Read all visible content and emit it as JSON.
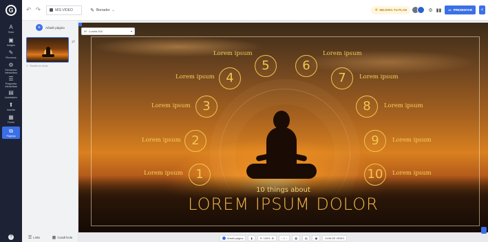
{
  "toolbar": {
    "file_name": "MIS VIDEO",
    "draft_label": "Borrador",
    "upgrade_label": "MEJORA TU PLAN",
    "present_label": "PRESENTAR"
  },
  "sidebar": {
    "items": [
      {
        "icon": "A",
        "label": "Texto"
      },
      {
        "icon": "▣",
        "label": "Imagen"
      },
      {
        "icon": "✎",
        "label": "Recursos"
      },
      {
        "icon": "⚙",
        "label": "Elementos interactivos"
      },
      {
        "icon": "☰",
        "label": "Preguntas interactivas"
      },
      {
        "icon": "▤",
        "label": "Insertables"
      },
      {
        "icon": "⬆",
        "label": "Insertar"
      },
      {
        "icon": "▦",
        "label": "Fondo"
      },
      {
        "icon": "⧉",
        "label": "Páginas"
      }
    ]
  },
  "pages_panel": {
    "add_page_label": "Añadir página",
    "thumb_label": "1 · Escrito en título",
    "footer": [
      {
        "icon": "☰",
        "label": "Lista"
      },
      {
        "icon": "▦",
        "label": "Cuadrícula"
      }
    ]
  },
  "canvas": {
    "font_selector": "Lustria 300",
    "subtitle": "10 things about",
    "title": "LOREM IPSUM DOLOR",
    "items": [
      {
        "n": "1",
        "text": "Lorem ipsum"
      },
      {
        "n": "2",
        "text": "Lorem ipsum"
      },
      {
        "n": "3",
        "text": "Lorem ipsum"
      },
      {
        "n": "4",
        "text": "Lorem ipsum"
      },
      {
        "n": "5",
        "text": "Lorem ipsum"
      },
      {
        "n": "6",
        "text": "Lorem ipsum"
      },
      {
        "n": "7",
        "text": "Lorem ipsum"
      },
      {
        "n": "8",
        "text": "Lorem ipsum"
      },
      {
        "n": "9",
        "text": "Lorem ipsum"
      },
      {
        "n": "10",
        "text": "Lorem ipsum"
      }
    ]
  },
  "bottom_bar": {
    "add_page": "Añadir página",
    "zoom": "100%",
    "page_current": "1",
    "guide_label": "GUÍA DE VÍDEO"
  }
}
